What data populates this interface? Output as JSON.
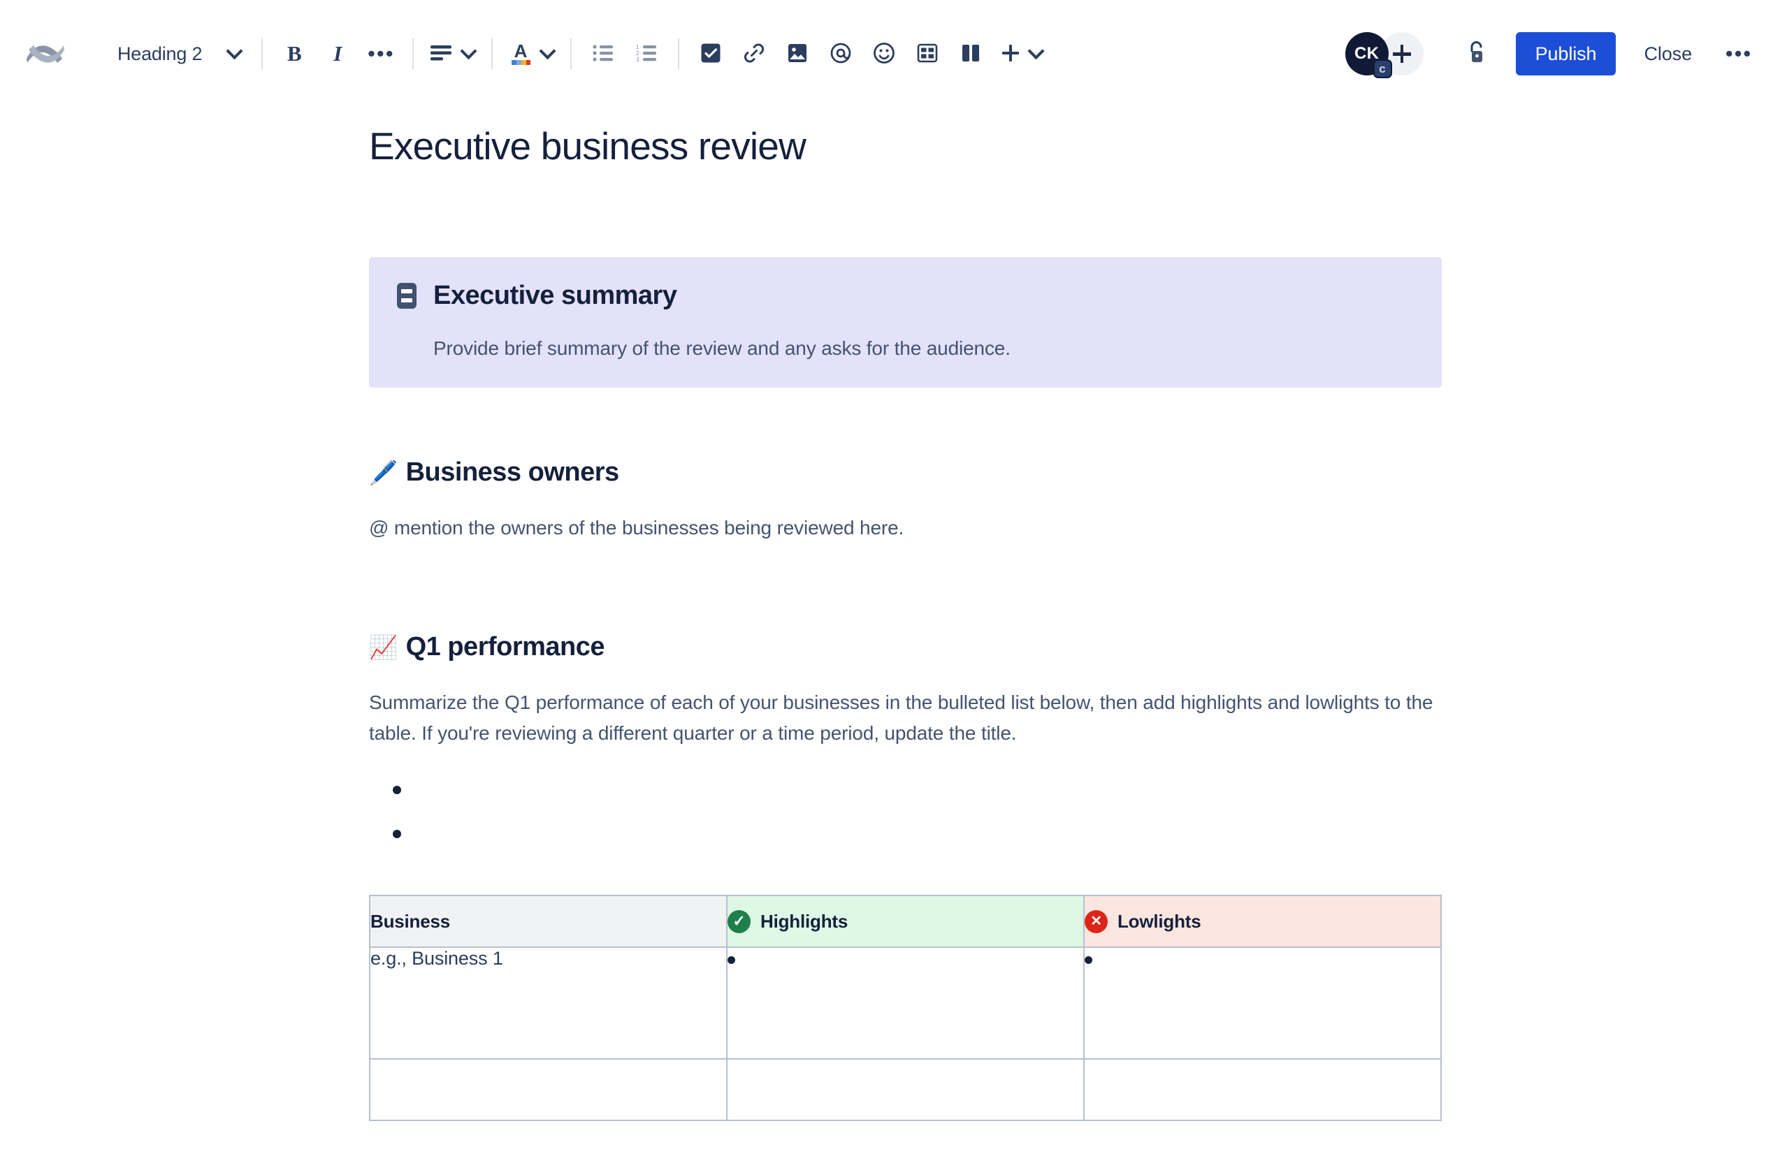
{
  "toolbar": {
    "logo_name": "confluence-logo",
    "style_select": {
      "value": "Heading 2"
    },
    "buttons": {
      "bold": "B",
      "italic": "I",
      "more_formatting": "•••",
      "text_align": "text-align",
      "text_color": "A",
      "bullet_list": "bullet-list",
      "numbered_list": "numbered-list",
      "action_item": "action-item",
      "link": "link",
      "image": "image",
      "mention": "@",
      "emoji": "emoji",
      "table": "table",
      "layout": "layout",
      "insert": "insert"
    },
    "avatar": {
      "initials": "CK",
      "badge": "c"
    },
    "add_people_label": "+",
    "restrictions_label": "restrictions",
    "publish_label": "Publish",
    "close_label": "Close",
    "more_label": "•••",
    "accent_color": "#1d4ed8"
  },
  "document": {
    "title": "Executive business review",
    "panel": {
      "icon": "note-icon",
      "title": "Executive summary",
      "body": "Provide brief summary of the review and any asks for the audience.",
      "background_color": "#e4e1fb"
    },
    "sections": [
      {
        "emoji": "🖊️",
        "heading": "Business owners",
        "paragraph": "@ mention the owners of the businesses being reviewed here."
      },
      {
        "emoji": "📈",
        "heading": "Q1 performance",
        "paragraph": "Summarize the Q1 performance of each of your businesses in the bulleted list below, then add highlights and lowlights to the table. If you're reviewing a different quarter or a time period, update the title.",
        "bullets": [
          "",
          ""
        ]
      }
    ],
    "table": {
      "headers": [
        {
          "label": "Business",
          "icon": null,
          "background_color": "#f1f2f4"
        },
        {
          "label": "Highlights",
          "icon": "check-circle-icon",
          "background_color": "#ddf8e4"
        },
        {
          "label": "Lowlights",
          "icon": "x-circle-icon",
          "background_color": "#fde6e0"
        }
      ],
      "rows": [
        {
          "business": "e.g., Business 1",
          "highlights": [
            ""
          ],
          "lowlights": [
            ""
          ]
        },
        {
          "business": "",
          "highlights": [],
          "lowlights": []
        }
      ]
    }
  }
}
